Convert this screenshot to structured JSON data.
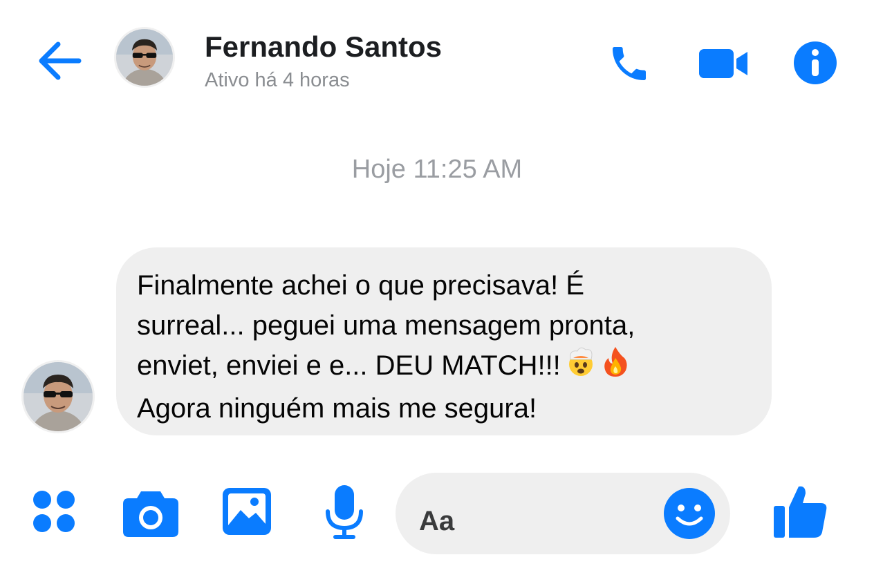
{
  "header": {
    "contact_name": "Fernando Santos",
    "status": "Ativo há 4 horas",
    "back_icon": "arrow-left-icon",
    "call_icon": "phone-icon",
    "video_icon": "video-camera-icon",
    "info_icon": "info-icon"
  },
  "conversation": {
    "timestamp": "Hoje 11:25 AM",
    "messages": [
      {
        "sender": "Fernando Santos",
        "lines": [
          "Finalmente achei o que precisava! É",
          "surreal... peguei uma mensagem pronta,",
          "enviet, enviei e e... DEU MATCH!!!",
          "Agora ninguém mais me segura!"
        ],
        "emojis": [
          "exploding-head-emoji",
          "fire-emoji"
        ]
      }
    ]
  },
  "composer": {
    "placeholder": "Aa",
    "icons": [
      "apps-icon",
      "camera-icon",
      "image-icon",
      "microphone-icon",
      "smiley-icon",
      "thumbs-up-icon"
    ]
  },
  "colors": {
    "accent": "#0a7cff",
    "bubble": "#efefef",
    "muted_text": "#8a8d91"
  }
}
